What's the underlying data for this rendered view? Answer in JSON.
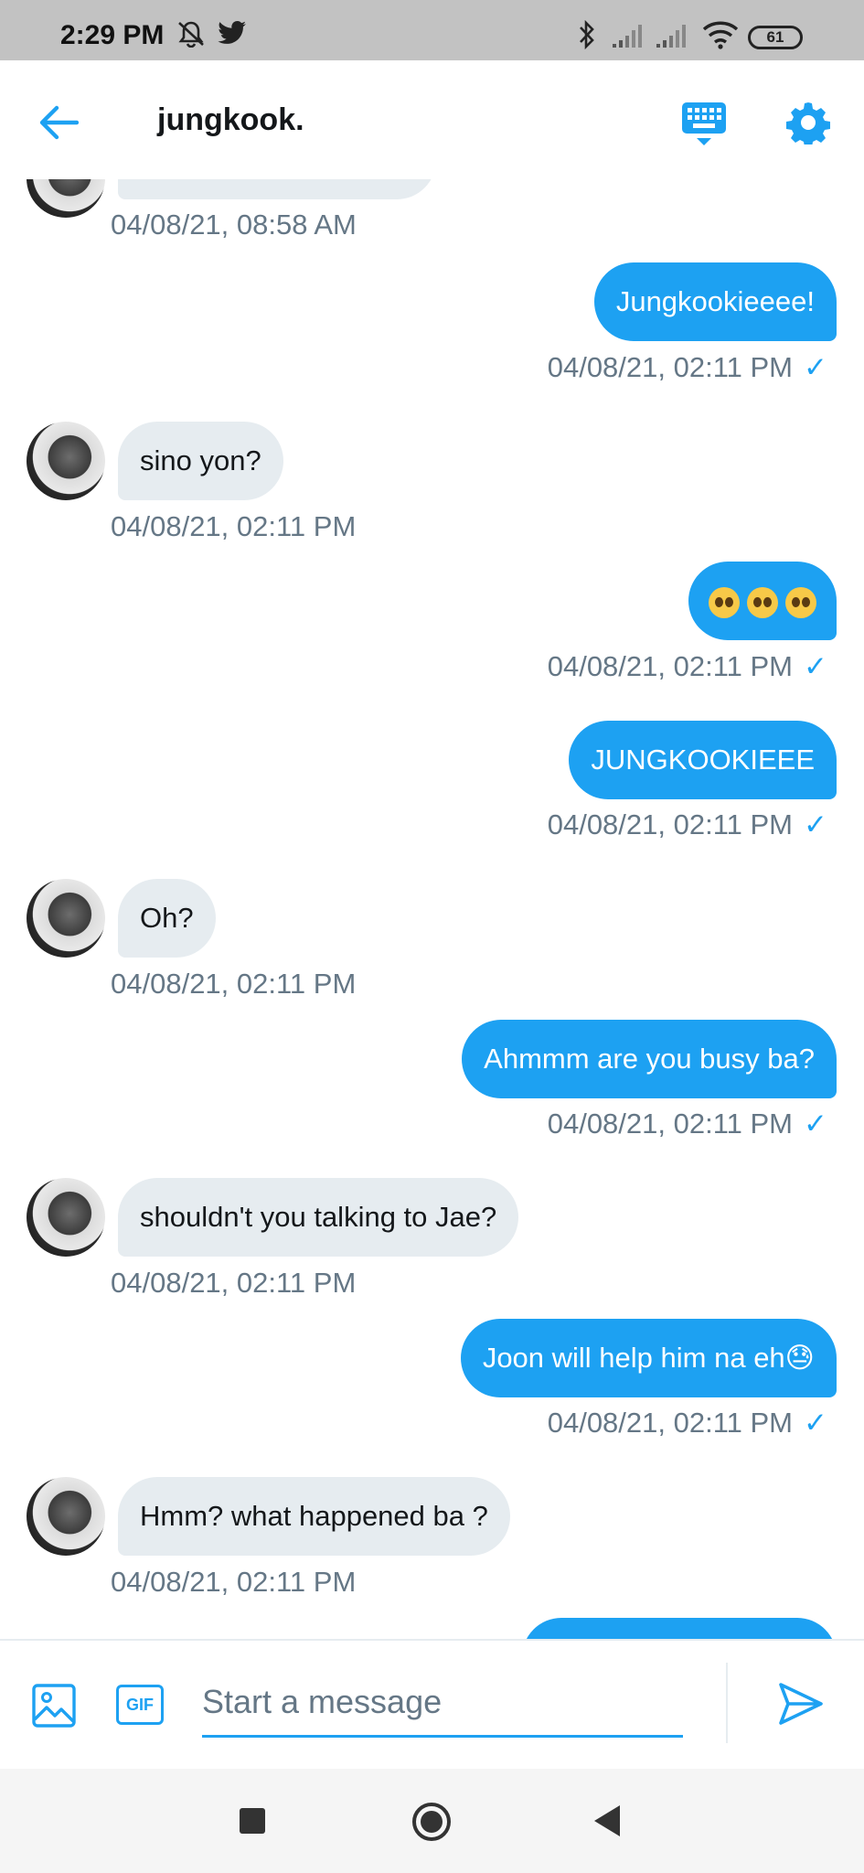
{
  "status_bar": {
    "time": "2:29 PM",
    "battery": "61",
    "icons": [
      "mute-notifications-icon",
      "twitter-icon",
      "bluetooth-icon",
      "signal-icon",
      "signal-icon",
      "wifi-icon",
      "battery-icon"
    ]
  },
  "header": {
    "title": "jungkook.",
    "icons": [
      "back-arrow-icon",
      "keyboard-icon",
      "gear-icon"
    ]
  },
  "messages": [
    {
      "direction": "incoming",
      "text": "",
      "timestamp": "04/08/21, 08:58 AM"
    },
    {
      "direction": "outgoing",
      "text": "Jungkookieeee!",
      "timestamp": "04/08/21, 02:11 PM",
      "read": "✓"
    },
    {
      "direction": "incoming",
      "text": "sino yon?",
      "timestamp": "04/08/21, 02:11 PM"
    },
    {
      "direction": "outgoing",
      "text": "🥺🥺🥺",
      "timestamp": "04/08/21, 02:11 PM",
      "read": "✓"
    },
    {
      "direction": "outgoing",
      "text": "JUNGKOOKIEEE",
      "timestamp": "04/08/21, 02:11 PM",
      "read": "✓"
    },
    {
      "direction": "incoming",
      "text": "Oh?",
      "timestamp": "04/08/21, 02:11 PM"
    },
    {
      "direction": "outgoing",
      "text": "Ahmmm are you busy ba?",
      "timestamp": "04/08/21, 02:11 PM",
      "read": "✓"
    },
    {
      "direction": "incoming",
      "text": "shouldn't you talking to Jae?",
      "timestamp": "04/08/21, 02:11 PM"
    },
    {
      "direction": "outgoing",
      "text": "Joon will help him na eh😓",
      "timestamp": "04/08/21, 02:11 PM",
      "read": "✓"
    },
    {
      "direction": "incoming",
      "text": "Hmm? what happened ba ?",
      "timestamp": "04/08/21, 02:11 PM"
    },
    {
      "direction": "outgoing",
      "text": "",
      "timestamp": ""
    }
  ],
  "composer": {
    "placeholder": "Start a message",
    "gif_label": "GIF",
    "icons": [
      "image-icon",
      "gif-icon",
      "send-icon"
    ]
  },
  "colors": {
    "accent": "#1da1f2",
    "incoming_bubble": "#e6ecf0",
    "timestamp": "#657786",
    "status_bar": "#c2c2c2"
  }
}
